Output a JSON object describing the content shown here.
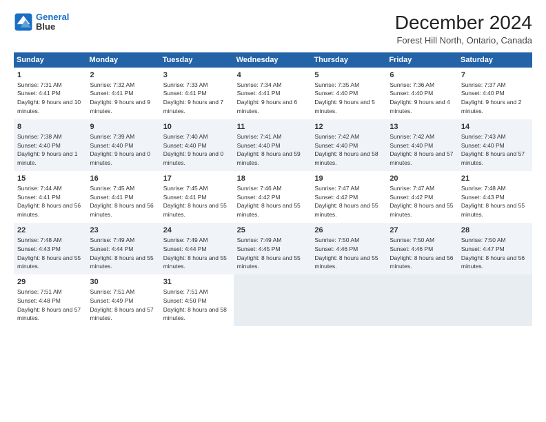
{
  "logo": {
    "line1": "General",
    "line2": "Blue"
  },
  "title": "December 2024",
  "subtitle": "Forest Hill North, Ontario, Canada",
  "headers": [
    "Sunday",
    "Monday",
    "Tuesday",
    "Wednesday",
    "Thursday",
    "Friday",
    "Saturday"
  ],
  "weeks": [
    [
      {
        "day": "1",
        "sunrise": "7:31 AM",
        "sunset": "4:41 PM",
        "daylight": "9 hours and 10 minutes."
      },
      {
        "day": "2",
        "sunrise": "7:32 AM",
        "sunset": "4:41 PM",
        "daylight": "9 hours and 9 minutes."
      },
      {
        "day": "3",
        "sunrise": "7:33 AM",
        "sunset": "4:41 PM",
        "daylight": "9 hours and 7 minutes."
      },
      {
        "day": "4",
        "sunrise": "7:34 AM",
        "sunset": "4:41 PM",
        "daylight": "9 hours and 6 minutes."
      },
      {
        "day": "5",
        "sunrise": "7:35 AM",
        "sunset": "4:40 PM",
        "daylight": "9 hours and 5 minutes."
      },
      {
        "day": "6",
        "sunrise": "7:36 AM",
        "sunset": "4:40 PM",
        "daylight": "9 hours and 4 minutes."
      },
      {
        "day": "7",
        "sunrise": "7:37 AM",
        "sunset": "4:40 PM",
        "daylight": "9 hours and 2 minutes."
      }
    ],
    [
      {
        "day": "8",
        "sunrise": "7:38 AM",
        "sunset": "4:40 PM",
        "daylight": "9 hours and 1 minute."
      },
      {
        "day": "9",
        "sunrise": "7:39 AM",
        "sunset": "4:40 PM",
        "daylight": "9 hours and 0 minutes."
      },
      {
        "day": "10",
        "sunrise": "7:40 AM",
        "sunset": "4:40 PM",
        "daylight": "9 hours and 0 minutes."
      },
      {
        "day": "11",
        "sunrise": "7:41 AM",
        "sunset": "4:40 PM",
        "daylight": "8 hours and 59 minutes."
      },
      {
        "day": "12",
        "sunrise": "7:42 AM",
        "sunset": "4:40 PM",
        "daylight": "8 hours and 58 minutes."
      },
      {
        "day": "13",
        "sunrise": "7:42 AM",
        "sunset": "4:40 PM",
        "daylight": "8 hours and 57 minutes."
      },
      {
        "day": "14",
        "sunrise": "7:43 AM",
        "sunset": "4:40 PM",
        "daylight": "8 hours and 57 minutes."
      }
    ],
    [
      {
        "day": "15",
        "sunrise": "7:44 AM",
        "sunset": "4:41 PM",
        "daylight": "8 hours and 56 minutes."
      },
      {
        "day": "16",
        "sunrise": "7:45 AM",
        "sunset": "4:41 PM",
        "daylight": "8 hours and 56 minutes."
      },
      {
        "day": "17",
        "sunrise": "7:45 AM",
        "sunset": "4:41 PM",
        "daylight": "8 hours and 55 minutes."
      },
      {
        "day": "18",
        "sunrise": "7:46 AM",
        "sunset": "4:42 PM",
        "daylight": "8 hours and 55 minutes."
      },
      {
        "day": "19",
        "sunrise": "7:47 AM",
        "sunset": "4:42 PM",
        "daylight": "8 hours and 55 minutes."
      },
      {
        "day": "20",
        "sunrise": "7:47 AM",
        "sunset": "4:42 PM",
        "daylight": "8 hours and 55 minutes."
      },
      {
        "day": "21",
        "sunrise": "7:48 AM",
        "sunset": "4:43 PM",
        "daylight": "8 hours and 55 minutes."
      }
    ],
    [
      {
        "day": "22",
        "sunrise": "7:48 AM",
        "sunset": "4:43 PM",
        "daylight": "8 hours and 55 minutes."
      },
      {
        "day": "23",
        "sunrise": "7:49 AM",
        "sunset": "4:44 PM",
        "daylight": "8 hours and 55 minutes."
      },
      {
        "day": "24",
        "sunrise": "7:49 AM",
        "sunset": "4:44 PM",
        "daylight": "8 hours and 55 minutes."
      },
      {
        "day": "25",
        "sunrise": "7:49 AM",
        "sunset": "4:45 PM",
        "daylight": "8 hours and 55 minutes."
      },
      {
        "day": "26",
        "sunrise": "7:50 AM",
        "sunset": "4:46 PM",
        "daylight": "8 hours and 55 minutes."
      },
      {
        "day": "27",
        "sunrise": "7:50 AM",
        "sunset": "4:46 PM",
        "daylight": "8 hours and 56 minutes."
      },
      {
        "day": "28",
        "sunrise": "7:50 AM",
        "sunset": "4:47 PM",
        "daylight": "8 hours and 56 minutes."
      }
    ],
    [
      {
        "day": "29",
        "sunrise": "7:51 AM",
        "sunset": "4:48 PM",
        "daylight": "8 hours and 57 minutes."
      },
      {
        "day": "30",
        "sunrise": "7:51 AM",
        "sunset": "4:49 PM",
        "daylight": "8 hours and 57 minutes."
      },
      {
        "day": "31",
        "sunrise": "7:51 AM",
        "sunset": "4:50 PM",
        "daylight": "8 hours and 58 minutes."
      },
      null,
      null,
      null,
      null
    ]
  ],
  "labels": {
    "sunrise": "Sunrise:",
    "sunset": "Sunset:",
    "daylight": "Daylight:"
  }
}
